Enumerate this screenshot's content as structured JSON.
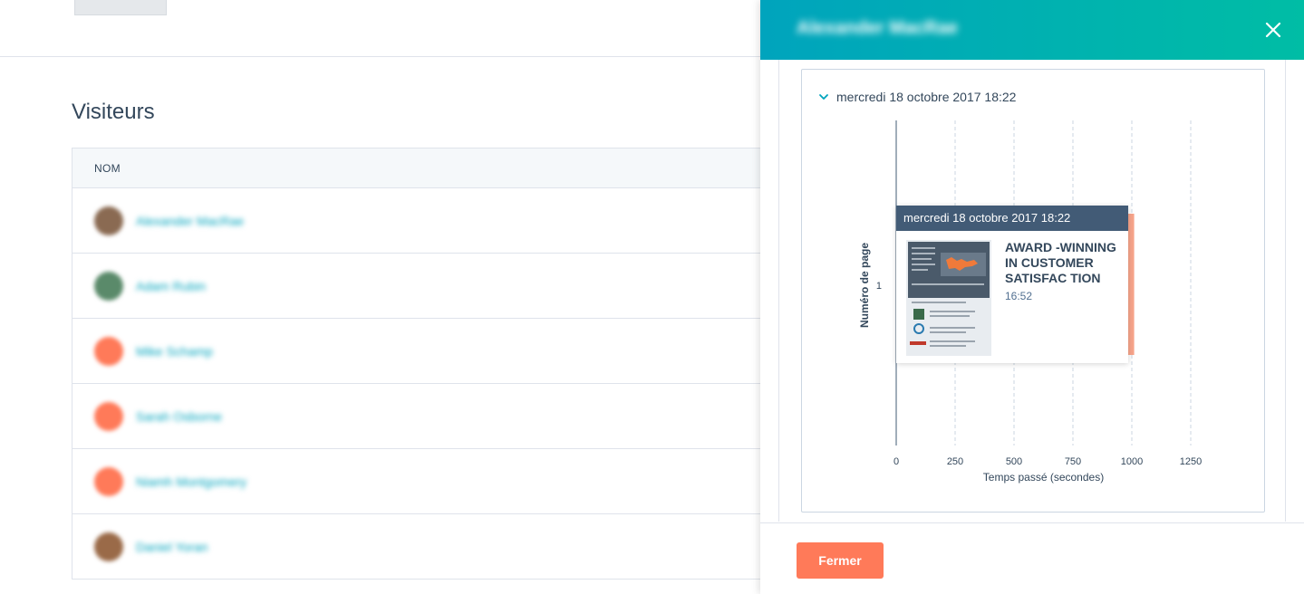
{
  "page": {
    "section_title": "Visiteurs",
    "table_header": "NOM",
    "visitors": [
      {
        "name": "Alexander MacRae",
        "avatar_color": "#8a6a52"
      },
      {
        "name": "Adam Rubin",
        "avatar_color": "#5a8a6a"
      },
      {
        "name": "Mike Schamp",
        "avatar_color": "#ff7a59"
      },
      {
        "name": "Sarah Osborne",
        "avatar_color": "#ff7a59"
      },
      {
        "name": "Niamh Montgomery",
        "avatar_color": "#ff7a59"
      },
      {
        "name": "Daniel Yoran",
        "avatar_color": "#9a6a48"
      }
    ]
  },
  "panel": {
    "title": "Alexander MacRae",
    "close_icon": "close-icon",
    "session_label": "mercredi 18 octobre 2017 18:22",
    "footer_button": "Fermer",
    "colors": {
      "header_start": "#00a4bd",
      "header_end": "#00bda5",
      "accent": "#ff7a59"
    }
  },
  "tooltip": {
    "header": "mercredi 18 octobre 2017 18:22",
    "page_title": "AWARD -WINNING IN CUSTOMER SATISFAC TION",
    "time": "16:52"
  },
  "chart_data": {
    "type": "bar",
    "orientation": "horizontal",
    "xlabel": "Temps passé (secondes)",
    "ylabel": "Numéro de page",
    "x_ticks": [
      0,
      250,
      500,
      750,
      1000,
      1250
    ],
    "y_ticks": [
      1
    ],
    "xlim": [
      0,
      1250
    ],
    "grid": "vertical-dashed",
    "series": [
      {
        "values": [
          {
            "page": 1,
            "seconds": 1010
          }
        ],
        "color": "#f8a58b"
      }
    ]
  }
}
